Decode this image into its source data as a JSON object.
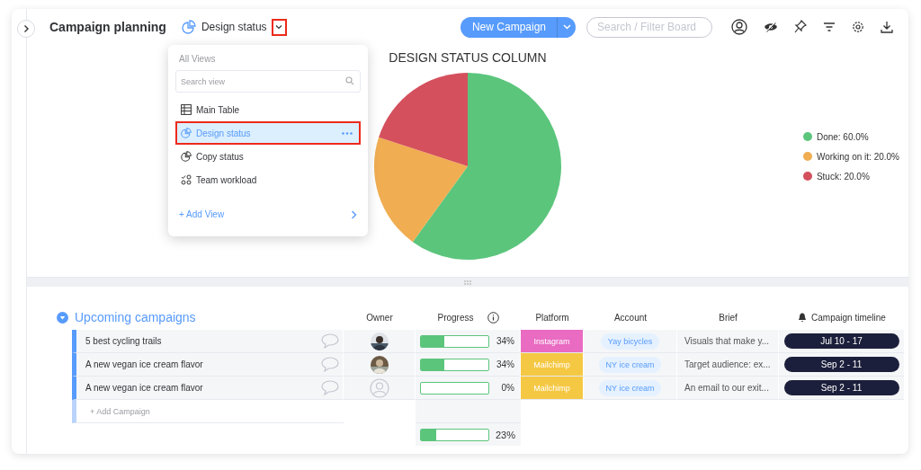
{
  "header": {
    "title": "Campaign planning",
    "view_name": "Design status",
    "view_toggle_highlighted": true,
    "new_button": "New Campaign",
    "search": {
      "placeholder": "Search / Filter Board"
    }
  },
  "views_menu": {
    "heading": "All Views",
    "search": {
      "placeholder": "Search view"
    },
    "items": [
      {
        "kind": "table",
        "label": "Main Table",
        "selected": false,
        "highlighted": false
      },
      {
        "kind": "chart",
        "label": "Design status",
        "selected": true,
        "highlighted": true
      },
      {
        "kind": "chart",
        "label": "Copy status",
        "selected": false,
        "highlighted": false
      },
      {
        "kind": "workload",
        "label": "Team workload",
        "selected": false,
        "highlighted": false
      }
    ],
    "add_view": "+ Add View"
  },
  "chart": {
    "chart_data": {
      "type": "pie",
      "title": "DESIGN STATUS COLUMN",
      "categories": [
        "Done: 60.0%",
        "Working on it: 20.0%",
        "Stuck: 20.0%"
      ],
      "series": [
        {
          "values": [
            60,
            20,
            20
          ]
        }
      ]
    },
    "legend": [
      {
        "color": "#5bc57c"
      },
      {
        "color": "#f0ad52"
      },
      {
        "color": "#d4505d"
      }
    ]
  },
  "group": {
    "title": "Upcoming campaigns",
    "columns": [
      "Owner",
      "Progress",
      "Platform",
      "Account",
      "Brief",
      "Campaign timeline"
    ],
    "rows": [
      {
        "name": "5 best cycling trails",
        "progress": {
          "level": 0.34,
          "reading": "34%"
        },
        "platform": {
          "label": "Instagram",
          "color": "#e96bc2"
        },
        "account": "Yay bicycles",
        "brief": "Visuals that make y...",
        "timeline": "Jul 10 - 17",
        "has_photo": true
      },
      {
        "name": "A new vegan ice cream flavor",
        "progress": {
          "level": 0.34,
          "reading": "34%"
        },
        "platform": {
          "label": "Mailchimp",
          "color": "#f5c844"
        },
        "account": "NY ice cream",
        "brief": "Target audience: ex...",
        "timeline": "Sep 2 - 11",
        "has_photo": true
      },
      {
        "name": "A new vegan ice cream flavor",
        "progress": {
          "level": 0,
          "reading": "0%"
        },
        "platform": {
          "label": "Mailchimp",
          "color": "#f5c844"
        },
        "account": "NY ice cream",
        "brief": "An email to our exit...",
        "timeline": "Sep 2 - 11",
        "has_photo": false
      }
    ],
    "add_row": "+ Add Campaign",
    "summary": {
      "level": 0.23,
      "reading": "23%"
    }
  }
}
